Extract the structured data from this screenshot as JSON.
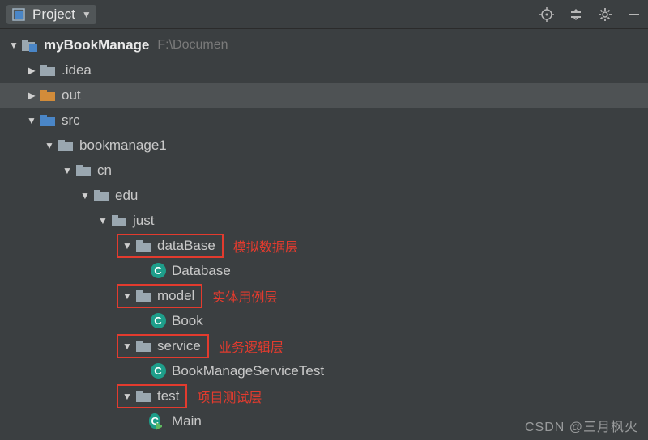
{
  "toolbar": {
    "project_label": "Project"
  },
  "project": {
    "name": "myBookManage",
    "path": "F:\\Documen"
  },
  "nodes": {
    "idea": ".idea",
    "out": "out",
    "src": "src",
    "bookmanage1": "bookmanage1",
    "cn": "cn",
    "edu": "edu",
    "just": "just",
    "dataBase": "dataBase",
    "database_cls": "Database",
    "model": "model",
    "book_cls": "Book",
    "service": "service",
    "bmst_cls": "BookManageServiceTest",
    "test": "test",
    "main_cls": "Main"
  },
  "annotations": {
    "dataBase": "模拟数据层",
    "model": "实体用例层",
    "service": "业务逻辑层",
    "test": "项目测试层"
  },
  "watermark": "CSDN @三月枫火",
  "class_initial": "C"
}
